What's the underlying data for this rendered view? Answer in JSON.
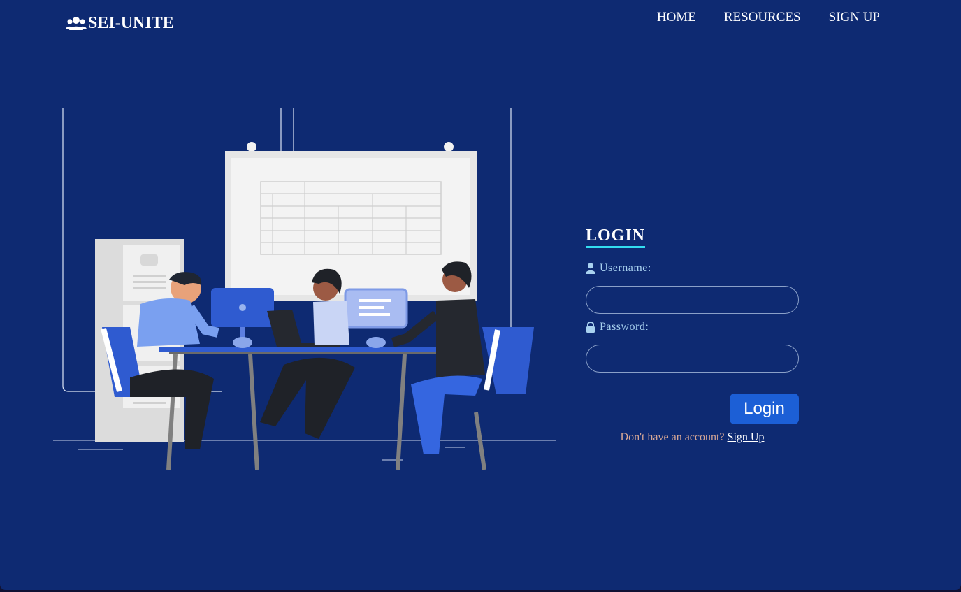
{
  "brand": {
    "name": "SEI-UNITE",
    "icon": "users-icon"
  },
  "nav": {
    "items": [
      "HOME",
      "RESOURCES",
      "SIGN UP"
    ]
  },
  "login": {
    "title": "LOGIN",
    "username_label": "Username:",
    "username_icon": "user-icon",
    "username_value": "",
    "password_label": "Password:",
    "password_icon": "lock-icon",
    "password_value": "",
    "submit_label": "Login",
    "signup_prompt": "Don't have an account?",
    "signup_link": "Sign Up"
  },
  "illustration": {
    "subject": "team-working-at-desk-illustration"
  },
  "colors": {
    "background": "#0e2a72",
    "accent_underline": "#33ddf0",
    "button": "#1c5fd6",
    "label": "#a9d2f0",
    "prompt": "#d8a896"
  }
}
